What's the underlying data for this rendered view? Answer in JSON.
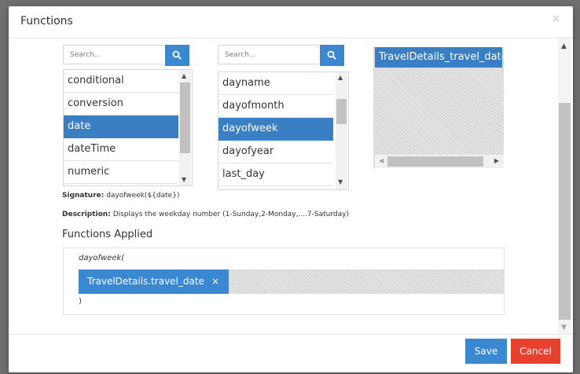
{
  "modal": {
    "title": "Functions",
    "close_glyph": "×"
  },
  "categories": {
    "search_placeholder": "Search...",
    "items": [
      {
        "label": "conditional",
        "selected": false
      },
      {
        "label": "conversion",
        "selected": false
      },
      {
        "label": "date",
        "selected": true
      },
      {
        "label": "dateTime",
        "selected": false
      },
      {
        "label": "numeric",
        "selected": false
      }
    ]
  },
  "functions": {
    "search_placeholder": "Search...",
    "items": [
      {
        "label": "dayname",
        "selected": false
      },
      {
        "label": "dayofmonth",
        "selected": false
      },
      {
        "label": "dayofweek",
        "selected": true
      },
      {
        "label": "dayofyear",
        "selected": false
      },
      {
        "label": "last_day",
        "selected": false
      }
    ]
  },
  "fields": {
    "items": [
      {
        "label": "TravelDetails_travel_date",
        "selected": true
      }
    ]
  },
  "signature": {
    "label": "Signature:",
    "value": "dayofweek(${date})"
  },
  "description": {
    "label": "Description:",
    "value": "Displays the weekday number (1-Sunday,2-Monday,....7-Saturday)"
  },
  "applied": {
    "title": "Functions Applied",
    "function_open": "dayofweek(",
    "token_label": "TravelDetails.travel_date",
    "token_remove_glyph": "×",
    "function_close": ")"
  },
  "footer": {
    "save_label": "Save",
    "cancel_label": "Cancel"
  },
  "colors": {
    "accent": "#3a88d2",
    "selected": "#3a7fc4",
    "danger": "#e8412e"
  },
  "icons": [
    "search-icon",
    "close-icon",
    "arrow-up-icon",
    "arrow-down-icon",
    "arrow-left-icon",
    "arrow-right-icon"
  ]
}
